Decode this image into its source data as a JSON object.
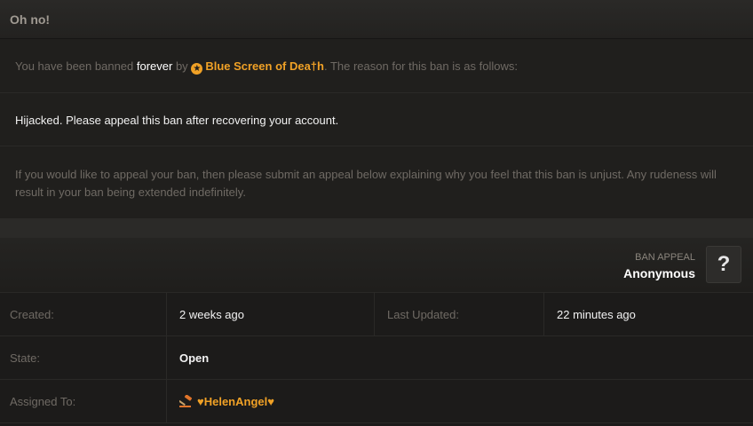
{
  "header": {
    "title": "Oh no!"
  },
  "ban": {
    "intro_before": "You have been banned ",
    "duration": "forever",
    "intro_by": " by ",
    "author": "Blue Screen of Dea†h",
    "intro_after": ". The reason for this ban is as follows:",
    "reason": "Hijacked. Please appeal this ban after recovering your account.",
    "notice": "If you would like to appeal your ban, then please submit an appeal below explaining why you feel that this ban is unjust. Any rudeness will result in your ban being extended indefinitely."
  },
  "appeal": {
    "label": "BAN APPEAL",
    "user": "Anonymous",
    "help_label": "?",
    "created_label": "Created:",
    "created_value": "2 weeks ago",
    "updated_label": "Last Updated:",
    "updated_value": "22 minutes ago",
    "state_label": "State:",
    "state_value": "Open",
    "assigned_label": "Assigned To:",
    "assigned_value": "♥HelenAngel♥"
  },
  "colors": {
    "accent": "#f0a126",
    "background": "#1c1b1a",
    "text_muted": "#6f6a64"
  },
  "icons": {
    "author_badge": "star-badge-icon",
    "assignee_badge": "gavel-icon"
  }
}
